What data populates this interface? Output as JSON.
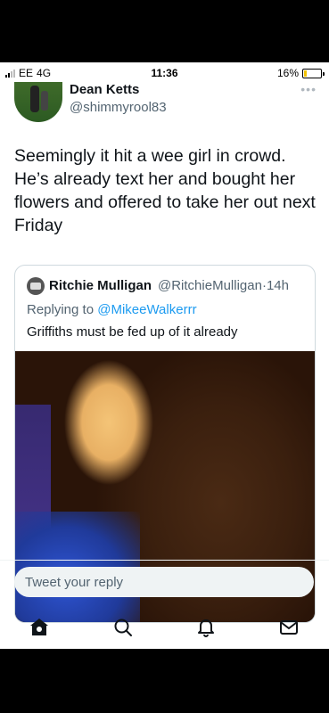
{
  "status_bar": {
    "carrier": "EE",
    "network": "4G",
    "time": "11:36",
    "battery_percent": "16%",
    "battery_level": 0.16
  },
  "tweet": {
    "author_name": "Dean Ketts",
    "author_handle": "@shimmyrool83",
    "more_icon": "more-dots-icon",
    "text": "Seemingly it hit a wee girl in crowd. He’s already text her and bought her flowers and offered to take her out next Friday"
  },
  "quoted_tweet": {
    "author_name": "Ritchie Mulligan",
    "author_handle": "@RitchieMulligan",
    "separator": "·",
    "time_ago": "14h",
    "replying_prefix": "Replying to",
    "replying_to": "@MikeeWalkerrr",
    "text": "Griffiths must be fed up of it already"
  },
  "reply": {
    "placeholder": "Tweet your reply"
  },
  "bottom_nav": {
    "items": [
      "home-icon",
      "search-icon",
      "notifications-icon",
      "messages-icon"
    ]
  },
  "colors": {
    "accent": "#1d9bf0",
    "text_primary": "#0f1419",
    "text_secondary": "#536471",
    "battery": "#f2c200"
  }
}
